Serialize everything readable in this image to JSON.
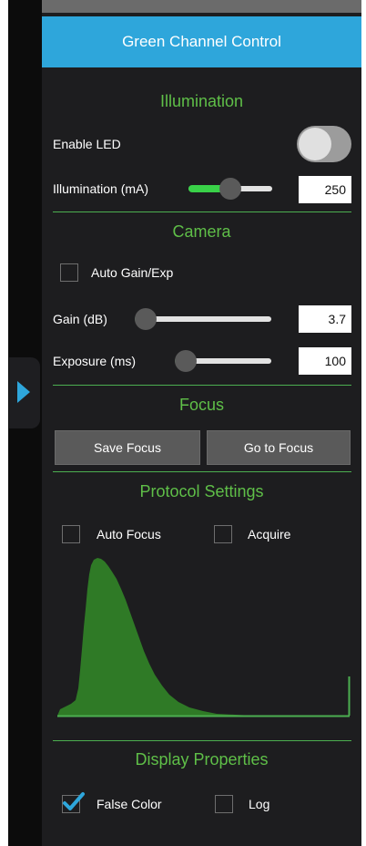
{
  "panel": {
    "title": "Green Channel Control"
  },
  "illumination": {
    "heading": "Illumination",
    "enable_led_label": "Enable LED",
    "enable_led_on": false,
    "illum_label": "Illumination (mA)",
    "illum_value": "250",
    "illum_slider_fraction": 0.5
  },
  "camera": {
    "heading": "Camera",
    "auto_gain_label": "Auto Gain/Exp",
    "auto_gain_checked": false,
    "gain_label": "Gain (dB)",
    "gain_value": "3.7",
    "gain_slider_fraction": 0.05,
    "exposure_label": "Exposure (ms)",
    "exposure_value": "100",
    "exposure_slider_fraction": 0.06
  },
  "focus": {
    "heading": "Focus",
    "save_label": "Save Focus",
    "goto_label": "Go to Focus"
  },
  "protocol": {
    "heading": "Protocol Settings",
    "auto_focus_label": "Auto Focus",
    "auto_focus_checked": false,
    "acquire_label": "Acquire",
    "acquire_checked": false
  },
  "display": {
    "heading": "Display Properties",
    "false_color_label": "False Color",
    "false_color_checked": true,
    "log_label": "Log",
    "log_checked": false
  },
  "colors": {
    "accent": "#2ea6db",
    "green": "#39d148",
    "section_text": "#5fbf48",
    "panel_bg": "#1d1d1f"
  },
  "icons": {
    "side_tab": "play-arrow-icon",
    "check": "checkmark-icon"
  }
}
